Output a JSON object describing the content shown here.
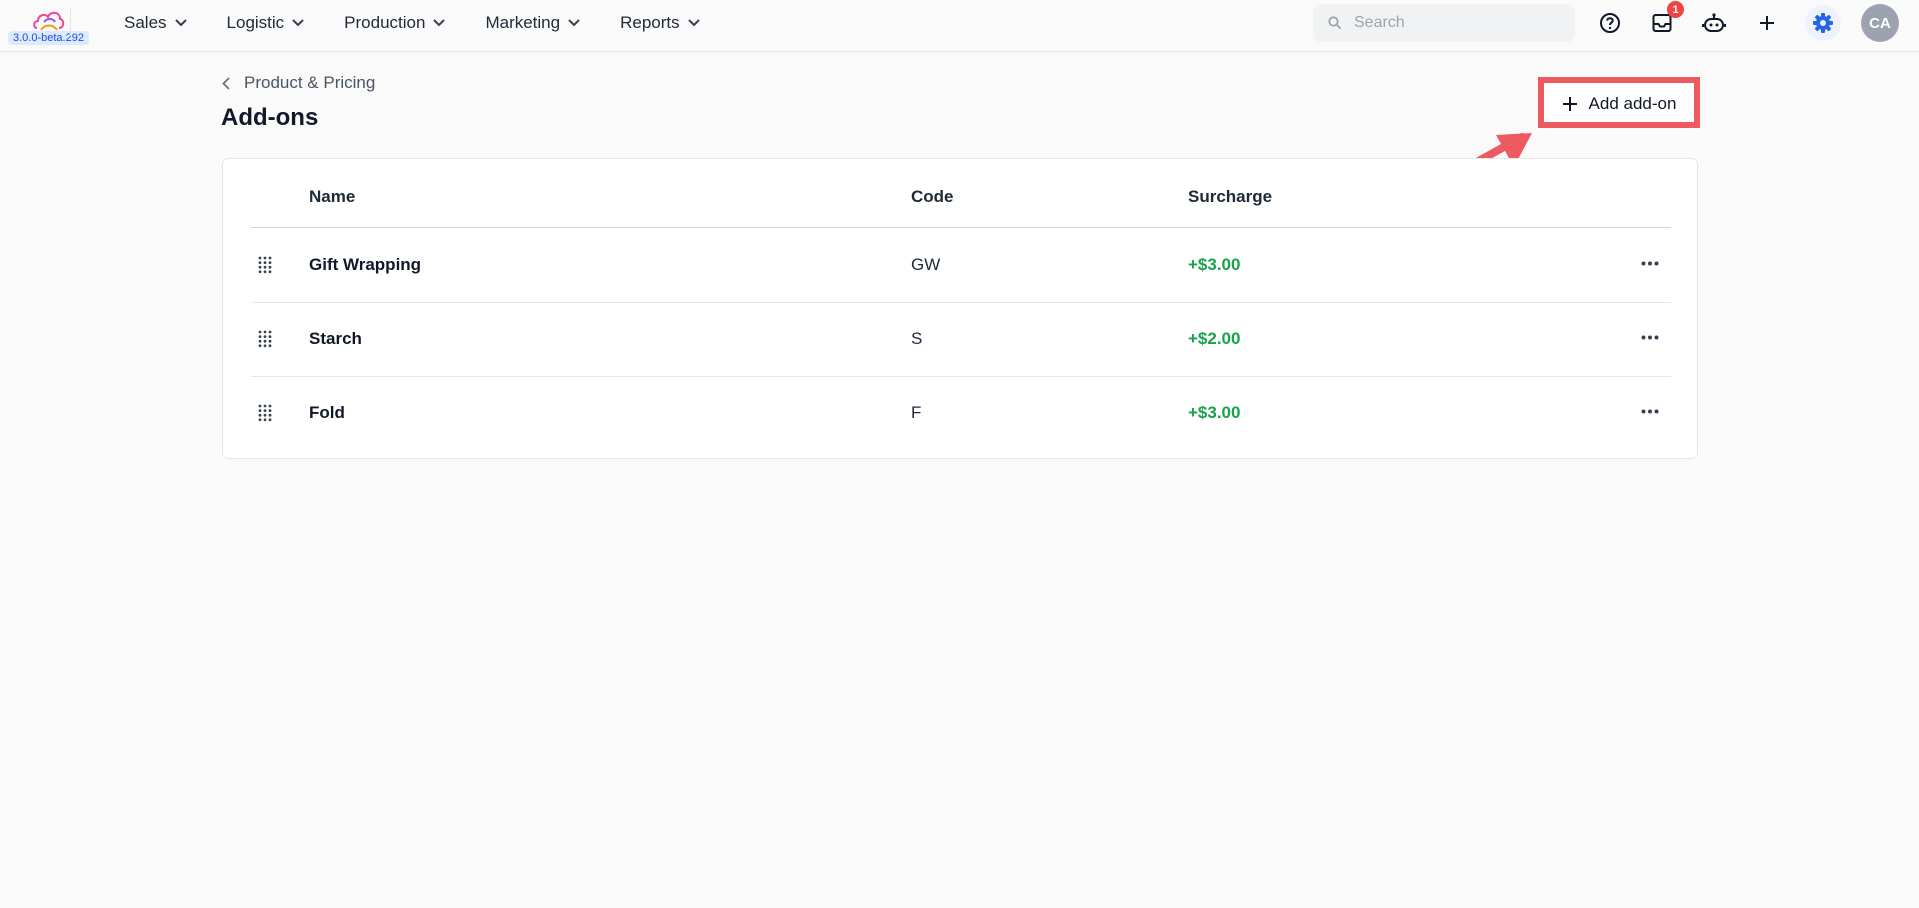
{
  "app": {
    "version": "3.0.0-beta.292"
  },
  "nav": {
    "items": [
      {
        "label": "Sales"
      },
      {
        "label": "Logistic"
      },
      {
        "label": "Production"
      },
      {
        "label": "Marketing"
      },
      {
        "label": "Reports"
      }
    ]
  },
  "search": {
    "placeholder": "Search",
    "value": ""
  },
  "toolbar": {
    "inbox_badge": "1",
    "avatar_initials": "CA",
    "icons": [
      "help-icon",
      "inbox-icon",
      "robot-icon",
      "plus-icon",
      "gear-icon"
    ]
  },
  "page": {
    "breadcrumb": "Product & Pricing",
    "title": "Add-ons",
    "add_button_label": "Add add-on"
  },
  "table": {
    "columns": {
      "name": "Name",
      "code": "Code",
      "surcharge": "Surcharge"
    },
    "rows": [
      {
        "name": "Gift Wrapping",
        "code": "GW",
        "surcharge": "+$3.00"
      },
      {
        "name": "Starch",
        "code": "S",
        "surcharge": "+$2.00"
      },
      {
        "name": "Fold",
        "code": "F",
        "surcharge": "+$3.00"
      }
    ]
  },
  "colors": {
    "accent": "#2563eb",
    "surcharge": "#16a34a",
    "highlight": "#ef5a60",
    "badge": "#ef4444"
  }
}
